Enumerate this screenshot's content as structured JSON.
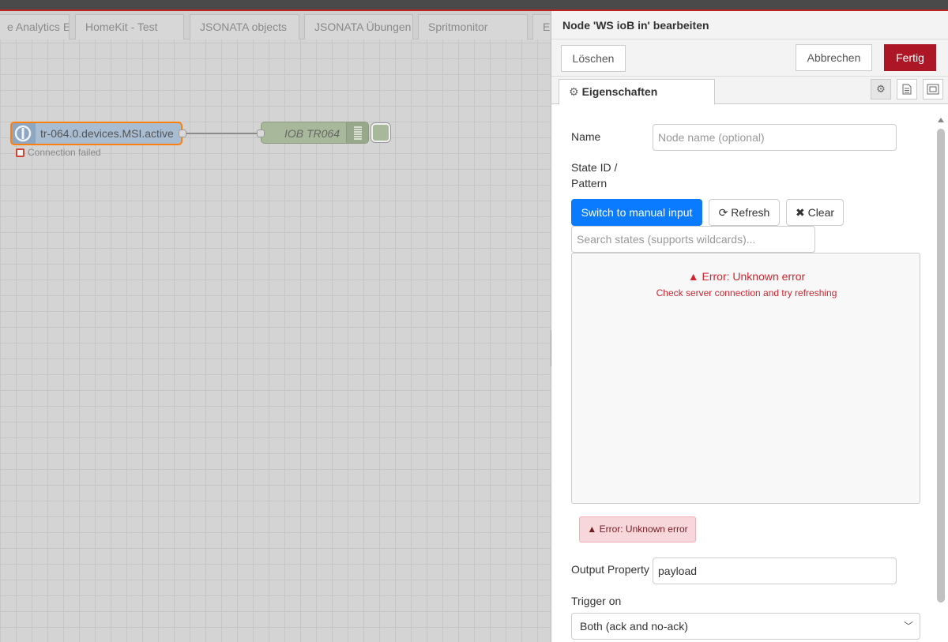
{
  "workspace": {
    "tabs": [
      {
        "label": "e Analytics En"
      },
      {
        "label": "HomeKit - Test"
      },
      {
        "label": "JSONATA objects"
      },
      {
        "label": "JSONATA Übungen"
      },
      {
        "label": "Spritmonitor"
      },
      {
        "label": "E"
      }
    ],
    "node_in": {
      "label": "tr-064.0.devices.MSI.active",
      "status": "Connection failed"
    },
    "node_out": {
      "label": "IOB TR064"
    }
  },
  "panel": {
    "title": "Node 'WS ioB in' bearbeiten",
    "delete_label": "Löschen",
    "cancel_label": "Abbrechen",
    "done_label": "Fertig",
    "tab_label": "Eigenschaften"
  },
  "form": {
    "name_label": "Name",
    "name_placeholder": "Node name (optional)",
    "state_label_1": "State ID /",
    "state_label_2": "Pattern",
    "manual_label": "Switch to manual input",
    "refresh_label": "Refresh",
    "clear_label": "Clear",
    "search_placeholder": "Search states (supports wildcards)...",
    "error_title": "Error: Unknown error",
    "error_sub": "Check server connection and try refreshing",
    "error_badge": "Error: Unknown error",
    "output_label": "Output Property",
    "output_value": "payload",
    "trigger_label": "Trigger on",
    "trigger_value": "Both (ack and no-ack)"
  },
  "colors": {
    "accent": "#ad1625",
    "primary": "#0a7bff",
    "error": "#d3242f",
    "selected_border": "#ff7f0e"
  }
}
